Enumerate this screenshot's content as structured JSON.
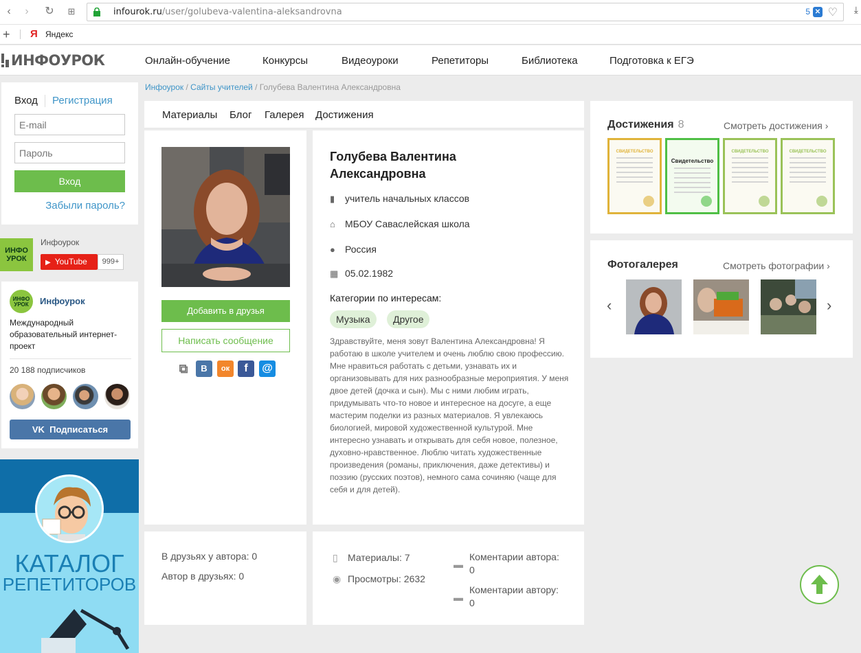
{
  "browser": {
    "url_host": "infourok.ru",
    "url_path": "/user/golubeva-valentina-aleksandrovna",
    "ext_count": "5",
    "bookmark": "Яндекс"
  },
  "header": {
    "logo": "ИНФОУРОК",
    "nav": [
      "Онлайн-обучение",
      "Конкурсы",
      "Видеоуроки",
      "Репетиторы",
      "Библиотека",
      "Подготовка к ЕГЭ"
    ]
  },
  "login": {
    "tab_login": "Вход",
    "tab_register": "Регистрация",
    "email_placeholder": "E-mail",
    "password_placeholder": "Пароль",
    "submit": "Вход",
    "forgot": "Забыли пароль?"
  },
  "youtube": {
    "channel": "Инфоурок",
    "button": "YouTube",
    "count": "999+",
    "logo_line1": "ИНФО",
    "logo_line2": "УРОК"
  },
  "vk": {
    "name": "Инфоурок",
    "description": "Международный образовательный интернет-проект",
    "subscribers": "20 188 подписчиков",
    "subscribe": "Подписаться"
  },
  "catalog": {
    "line1": "КАТАЛОГ",
    "line2": "РЕПЕТИТОРОВ"
  },
  "breadcrumb": {
    "items": [
      "Инфоурок",
      "Сайты учителей"
    ],
    "current": "Голубева Валентина Александровна"
  },
  "tabs": [
    "Материалы",
    "Блог",
    "Галерея",
    "Достижения"
  ],
  "profile": {
    "name_line1": "Голубева Валентина",
    "name_line2": "Александровна",
    "position": "учитель начальных классов",
    "school": "МБОУ Саваслейская школа",
    "country": "Россия",
    "birthdate": "05.02.1982",
    "interests_label": "Категории по интересам:",
    "interests": [
      "Музыка",
      "Другое"
    ],
    "about": "Здравствуйте, меня зовут Валентина Александровна! Я работаю в школе учителем и очень люблю свою профессию. Мне нравиться работать с детьми, узнавать их и организовывать для них разнообразные мероприятия. У меня двое детей (дочка и сын). Мы с ними любим играть, придумывать что-то новое и интересное на досуге, а еще мастерим поделки из разных материалов. Я увлекаюсь биологией, мировой художественной культурой. Мне интересно узнавать и открывать для себя новое, полезное, духовно-нравственное. Люблю читать художественные произведения (романы, приключения, даже детективы) и поэзию (русских поэтов), немного сама сочиняю (чаще для себя и для детей).",
    "add_friend": "Добавить в друзья",
    "write_message": "Написать сообщение"
  },
  "share": {
    "vk": "В",
    "ok": "ок",
    "fb": "f",
    "mail": "@"
  },
  "friends": {
    "in_friends": "В друзьях у автора: 0",
    "author_in_friends": "Автор в друзьях: 0"
  },
  "stats": {
    "materials": "Материалы: 7",
    "views": "Просмотры: 2632",
    "comments_by_line1": "Коментарии автора:",
    "comments_by_count": "0",
    "comments_to_line1": "Коментарии автору:",
    "comments_to_count": "0"
  },
  "achievements": {
    "title": "Достижения",
    "count": "8",
    "link": "Смотреть достижения ›",
    "certificates": [
      {
        "label": "СВИДЕТЕЛЬСТВО",
        "color": "#e0b33a"
      },
      {
        "label": "Свидетельство",
        "color": "#4fbf45"
      },
      {
        "label": "СВИДЕТЕЛЬСТВО",
        "color": "#9ac258"
      },
      {
        "label": "СВИДЕТЕЛЬСТВО",
        "color": "#9ac258"
      }
    ]
  },
  "gallery": {
    "title": "Фотогалерея",
    "link": "Смотреть фотографии ›",
    "prev": "‹",
    "next": "›"
  },
  "colors": {
    "brand_green": "#6dbd4c",
    "link_blue": "#3f95c8",
    "vk_blue": "#4a76a8"
  }
}
